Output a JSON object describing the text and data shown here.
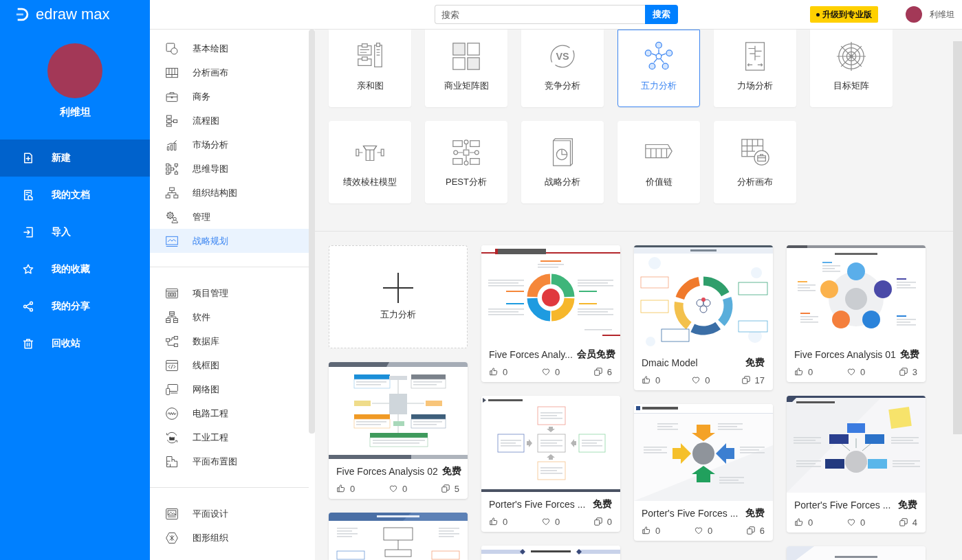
{
  "sidebar": {
    "logo": "edraw max",
    "user_name": "利维坦",
    "items": [
      {
        "label": "新建",
        "selected": true
      },
      {
        "label": "我的文档",
        "selected": false
      },
      {
        "label": "导入",
        "selected": false
      },
      {
        "label": "我的收藏",
        "selected": false
      },
      {
        "label": "我的分享",
        "selected": false
      },
      {
        "label": "回收站",
        "selected": false
      }
    ]
  },
  "topbar": {
    "search": {
      "placeholder": "搜索",
      "button": "搜索"
    },
    "upgrade_button": "升级到专业版",
    "user_name": "利维坦"
  },
  "categories": [
    {
      "items": [
        {
          "label": "基本绘图",
          "selected": false
        },
        {
          "label": "分析画布",
          "selected": false
        },
        {
          "label": "商务",
          "selected": false
        },
        {
          "label": "流程图",
          "selected": false
        },
        {
          "label": "市场分析",
          "selected": false
        },
        {
          "label": "思维导图",
          "selected": false
        },
        {
          "label": "组织结构图",
          "selected": false
        },
        {
          "label": "管理",
          "selected": false
        },
        {
          "label": "战略规划",
          "selected": true
        }
      ]
    },
    {
      "items": [
        {
          "label": "项目管理",
          "selected": false
        },
        {
          "label": "软件",
          "selected": false
        },
        {
          "label": "数据库",
          "selected": false
        },
        {
          "label": "线框图",
          "selected": false
        },
        {
          "label": "网络图",
          "selected": false
        },
        {
          "label": "电路工程",
          "selected": false
        },
        {
          "label": "工业工程",
          "selected": false
        },
        {
          "label": "平面布置图",
          "selected": false
        }
      ]
    },
    {
      "items": [
        {
          "label": "平面设计",
          "selected": false
        },
        {
          "label": "图形组织",
          "selected": false
        }
      ]
    }
  ],
  "diagram_types": [
    {
      "label": "亲和图",
      "selected": false
    },
    {
      "label": "商业矩阵图",
      "selected": false
    },
    {
      "label": "竞争分析",
      "selected": false,
      "icon_text": "VS"
    },
    {
      "label": "五力分析",
      "selected": true
    },
    {
      "label": "力场分析",
      "selected": false
    },
    {
      "label": "目标矩阵",
      "selected": false
    },
    {
      "label": "绩效棱柱模型",
      "selected": false
    },
    {
      "label": "PEST分析",
      "selected": false
    },
    {
      "label": "战略分析",
      "selected": false
    },
    {
      "label": "价值链",
      "selected": false
    },
    {
      "label": "分析画布",
      "selected": false
    }
  ],
  "new_template": {
    "label": "五力分析"
  },
  "template_columns": [
    [
      {
        "kind": "box",
        "title": "Five Forces Analysis 02",
        "price": "免费",
        "likes": "0",
        "favorites": "0",
        "copies": "5"
      },
      {
        "kind": "tree"
      }
    ],
    [
      {
        "kind": "cycle",
        "title": "Five Forces Analy...",
        "price": "会员免费",
        "likes": "0",
        "favorites": "0",
        "copies": "6"
      },
      {
        "kind": "flow",
        "title": "Porter's Five Forces ...",
        "price": "免费",
        "likes": "0",
        "favorites": "0",
        "copies": "0"
      },
      {
        "kind": "banner"
      }
    ],
    [
      {
        "kind": "ring",
        "title": "Dmaic Model",
        "price": "免费",
        "likes": "0",
        "favorites": "0",
        "copies": "17"
      },
      {
        "kind": "arrow",
        "title": "Porter's Five Forces ...",
        "price": "免费",
        "likes": "0",
        "favorites": "0",
        "copies": "6"
      }
    ],
    [
      {
        "kind": "hub",
        "title": "Five Forces Analysis 01",
        "price": "免费",
        "likes": "0",
        "favorites": "0",
        "copies": "3"
      },
      {
        "kind": "network",
        "title": "Porter's Five Forces ...",
        "price": "免费",
        "likes": "0",
        "favorites": "0",
        "copies": "4"
      },
      {
        "kind": "plain"
      }
    ]
  ]
}
